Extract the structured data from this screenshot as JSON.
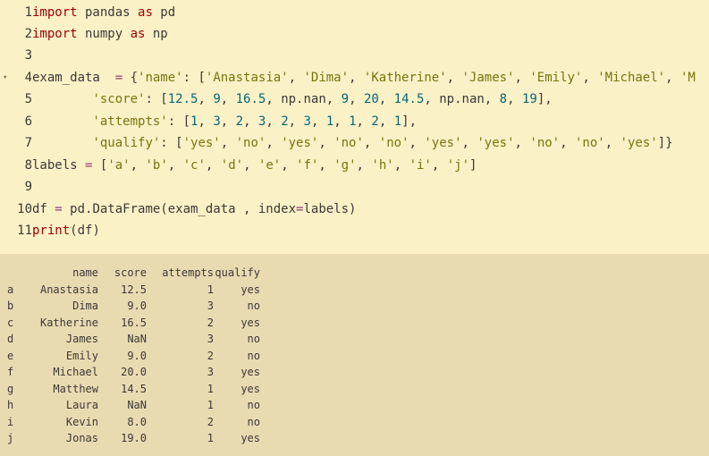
{
  "editor": {
    "lines": [
      {
        "num": "1",
        "fold": false,
        "tokens": [
          [
            "kw",
            "import"
          ],
          [
            "nn",
            " pandas "
          ],
          [
            "kw",
            "as"
          ],
          [
            "nn",
            " pd"
          ]
        ]
      },
      {
        "num": "2",
        "fold": false,
        "tokens": [
          [
            "kw",
            "import"
          ],
          [
            "nn",
            " numpy "
          ],
          [
            "kw",
            "as"
          ],
          [
            "nn",
            " np"
          ]
        ]
      },
      {
        "num": "3",
        "fold": false,
        "tokens": []
      },
      {
        "num": "4",
        "fold": true,
        "tokens": [
          [
            "nn",
            "exam_data  "
          ],
          [
            "op",
            "="
          ],
          [
            "nn",
            " {"
          ],
          [
            "str",
            "'name'"
          ],
          [
            "nn",
            ": ["
          ],
          [
            "str",
            "'Anastasia'"
          ],
          [
            "nn",
            ", "
          ],
          [
            "str",
            "'Dima'"
          ],
          [
            "nn",
            ", "
          ],
          [
            "str",
            "'Katherine'"
          ],
          [
            "nn",
            ", "
          ],
          [
            "str",
            "'James'"
          ],
          [
            "nn",
            ", "
          ],
          [
            "str",
            "'Emily'"
          ],
          [
            "nn",
            ", "
          ],
          [
            "str",
            "'Michael'"
          ],
          [
            "nn",
            ", "
          ],
          [
            "str",
            "'M"
          ]
        ]
      },
      {
        "num": "5",
        "fold": false,
        "tokens": [
          [
            "nn",
            "        "
          ],
          [
            "str",
            "'score'"
          ],
          [
            "nn",
            ": ["
          ],
          [
            "num",
            "12.5"
          ],
          [
            "nn",
            ", "
          ],
          [
            "num",
            "9"
          ],
          [
            "nn",
            ", "
          ],
          [
            "num",
            "16.5"
          ],
          [
            "nn",
            ", np.nan, "
          ],
          [
            "num",
            "9"
          ],
          [
            "nn",
            ", "
          ],
          [
            "num",
            "20"
          ],
          [
            "nn",
            ", "
          ],
          [
            "num",
            "14.5"
          ],
          [
            "nn",
            ", np.nan, "
          ],
          [
            "num",
            "8"
          ],
          [
            "nn",
            ", "
          ],
          [
            "num",
            "19"
          ],
          [
            "nn",
            "],"
          ]
        ]
      },
      {
        "num": "6",
        "fold": false,
        "tokens": [
          [
            "nn",
            "        "
          ],
          [
            "str",
            "'attempts'"
          ],
          [
            "nn",
            ": ["
          ],
          [
            "num",
            "1"
          ],
          [
            "nn",
            ", "
          ],
          [
            "num",
            "3"
          ],
          [
            "nn",
            ", "
          ],
          [
            "num",
            "2"
          ],
          [
            "nn",
            ", "
          ],
          [
            "num",
            "3"
          ],
          [
            "nn",
            ", "
          ],
          [
            "num",
            "2"
          ],
          [
            "nn",
            ", "
          ],
          [
            "num",
            "3"
          ],
          [
            "nn",
            ", "
          ],
          [
            "num",
            "1"
          ],
          [
            "nn",
            ", "
          ],
          [
            "num",
            "1"
          ],
          [
            "nn",
            ", "
          ],
          [
            "num",
            "2"
          ],
          [
            "nn",
            ", "
          ],
          [
            "num",
            "1"
          ],
          [
            "nn",
            "],"
          ]
        ]
      },
      {
        "num": "7",
        "fold": false,
        "tokens": [
          [
            "nn",
            "        "
          ],
          [
            "str",
            "'qualify'"
          ],
          [
            "nn",
            ": ["
          ],
          [
            "str",
            "'yes'"
          ],
          [
            "nn",
            ", "
          ],
          [
            "str",
            "'no'"
          ],
          [
            "nn",
            ", "
          ],
          [
            "str",
            "'yes'"
          ],
          [
            "nn",
            ", "
          ],
          [
            "str",
            "'no'"
          ],
          [
            "nn",
            ", "
          ],
          [
            "str",
            "'no'"
          ],
          [
            "nn",
            ", "
          ],
          [
            "str",
            "'yes'"
          ],
          [
            "nn",
            ", "
          ],
          [
            "str",
            "'yes'"
          ],
          [
            "nn",
            ", "
          ],
          [
            "str",
            "'no'"
          ],
          [
            "nn",
            ", "
          ],
          [
            "str",
            "'no'"
          ],
          [
            "nn",
            ", "
          ],
          [
            "str",
            "'yes'"
          ],
          [
            "nn",
            "]}"
          ]
        ]
      },
      {
        "num": "8",
        "fold": false,
        "tokens": [
          [
            "nn",
            "labels "
          ],
          [
            "op",
            "="
          ],
          [
            "nn",
            " ["
          ],
          [
            "str",
            "'a'"
          ],
          [
            "nn",
            ", "
          ],
          [
            "str",
            "'b'"
          ],
          [
            "nn",
            ", "
          ],
          [
            "str",
            "'c'"
          ],
          [
            "nn",
            ", "
          ],
          [
            "str",
            "'d'"
          ],
          [
            "nn",
            ", "
          ],
          [
            "str",
            "'e'"
          ],
          [
            "nn",
            ", "
          ],
          [
            "str",
            "'f'"
          ],
          [
            "nn",
            ", "
          ],
          [
            "str",
            "'g'"
          ],
          [
            "nn",
            ", "
          ],
          [
            "str",
            "'h'"
          ],
          [
            "nn",
            ", "
          ],
          [
            "str",
            "'i'"
          ],
          [
            "nn",
            ", "
          ],
          [
            "str",
            "'j'"
          ],
          [
            "nn",
            "]"
          ]
        ]
      },
      {
        "num": "9",
        "fold": false,
        "tokens": []
      },
      {
        "num": "10",
        "fold": false,
        "tokens": [
          [
            "nn",
            "df "
          ],
          [
            "op",
            "="
          ],
          [
            "nn",
            " pd.DataFrame(exam_data , index"
          ],
          [
            "op",
            "="
          ],
          [
            "nn",
            "labels)"
          ]
        ]
      },
      {
        "num": "11",
        "fold": false,
        "tokens": [
          [
            "kw",
            "print"
          ],
          [
            "nn",
            "(df)"
          ]
        ]
      }
    ]
  },
  "output": {
    "headers": [
      "",
      "name",
      "score",
      "attempts",
      "qualify"
    ],
    "rows": [
      [
        "a",
        "Anastasia",
        "12.5",
        "1",
        "yes"
      ],
      [
        "b",
        "Dima",
        "9.0",
        "3",
        "no"
      ],
      [
        "c",
        "Katherine",
        "16.5",
        "2",
        "yes"
      ],
      [
        "d",
        "James",
        "NaN",
        "3",
        "no"
      ],
      [
        "e",
        "Emily",
        "9.0",
        "2",
        "no"
      ],
      [
        "f",
        "Michael",
        "20.0",
        "3",
        "yes"
      ],
      [
        "g",
        "Matthew",
        "14.5",
        "1",
        "yes"
      ],
      [
        "h",
        "Laura",
        "NaN",
        "1",
        "no"
      ],
      [
        "i",
        "Kevin",
        "8.0",
        "2",
        "no"
      ],
      [
        "j",
        "Jonas",
        "19.0",
        "1",
        "yes"
      ]
    ]
  },
  "colors": {
    "editor_bg": "#fbf1c7",
    "output_bg": "#e9dbb1",
    "keyword": "#9d0006",
    "string": "#79740e",
    "number": "#076678",
    "operator": "#8f3f71",
    "text": "#3c3836"
  },
  "icons": {
    "fold": "chevron-down-icon"
  }
}
